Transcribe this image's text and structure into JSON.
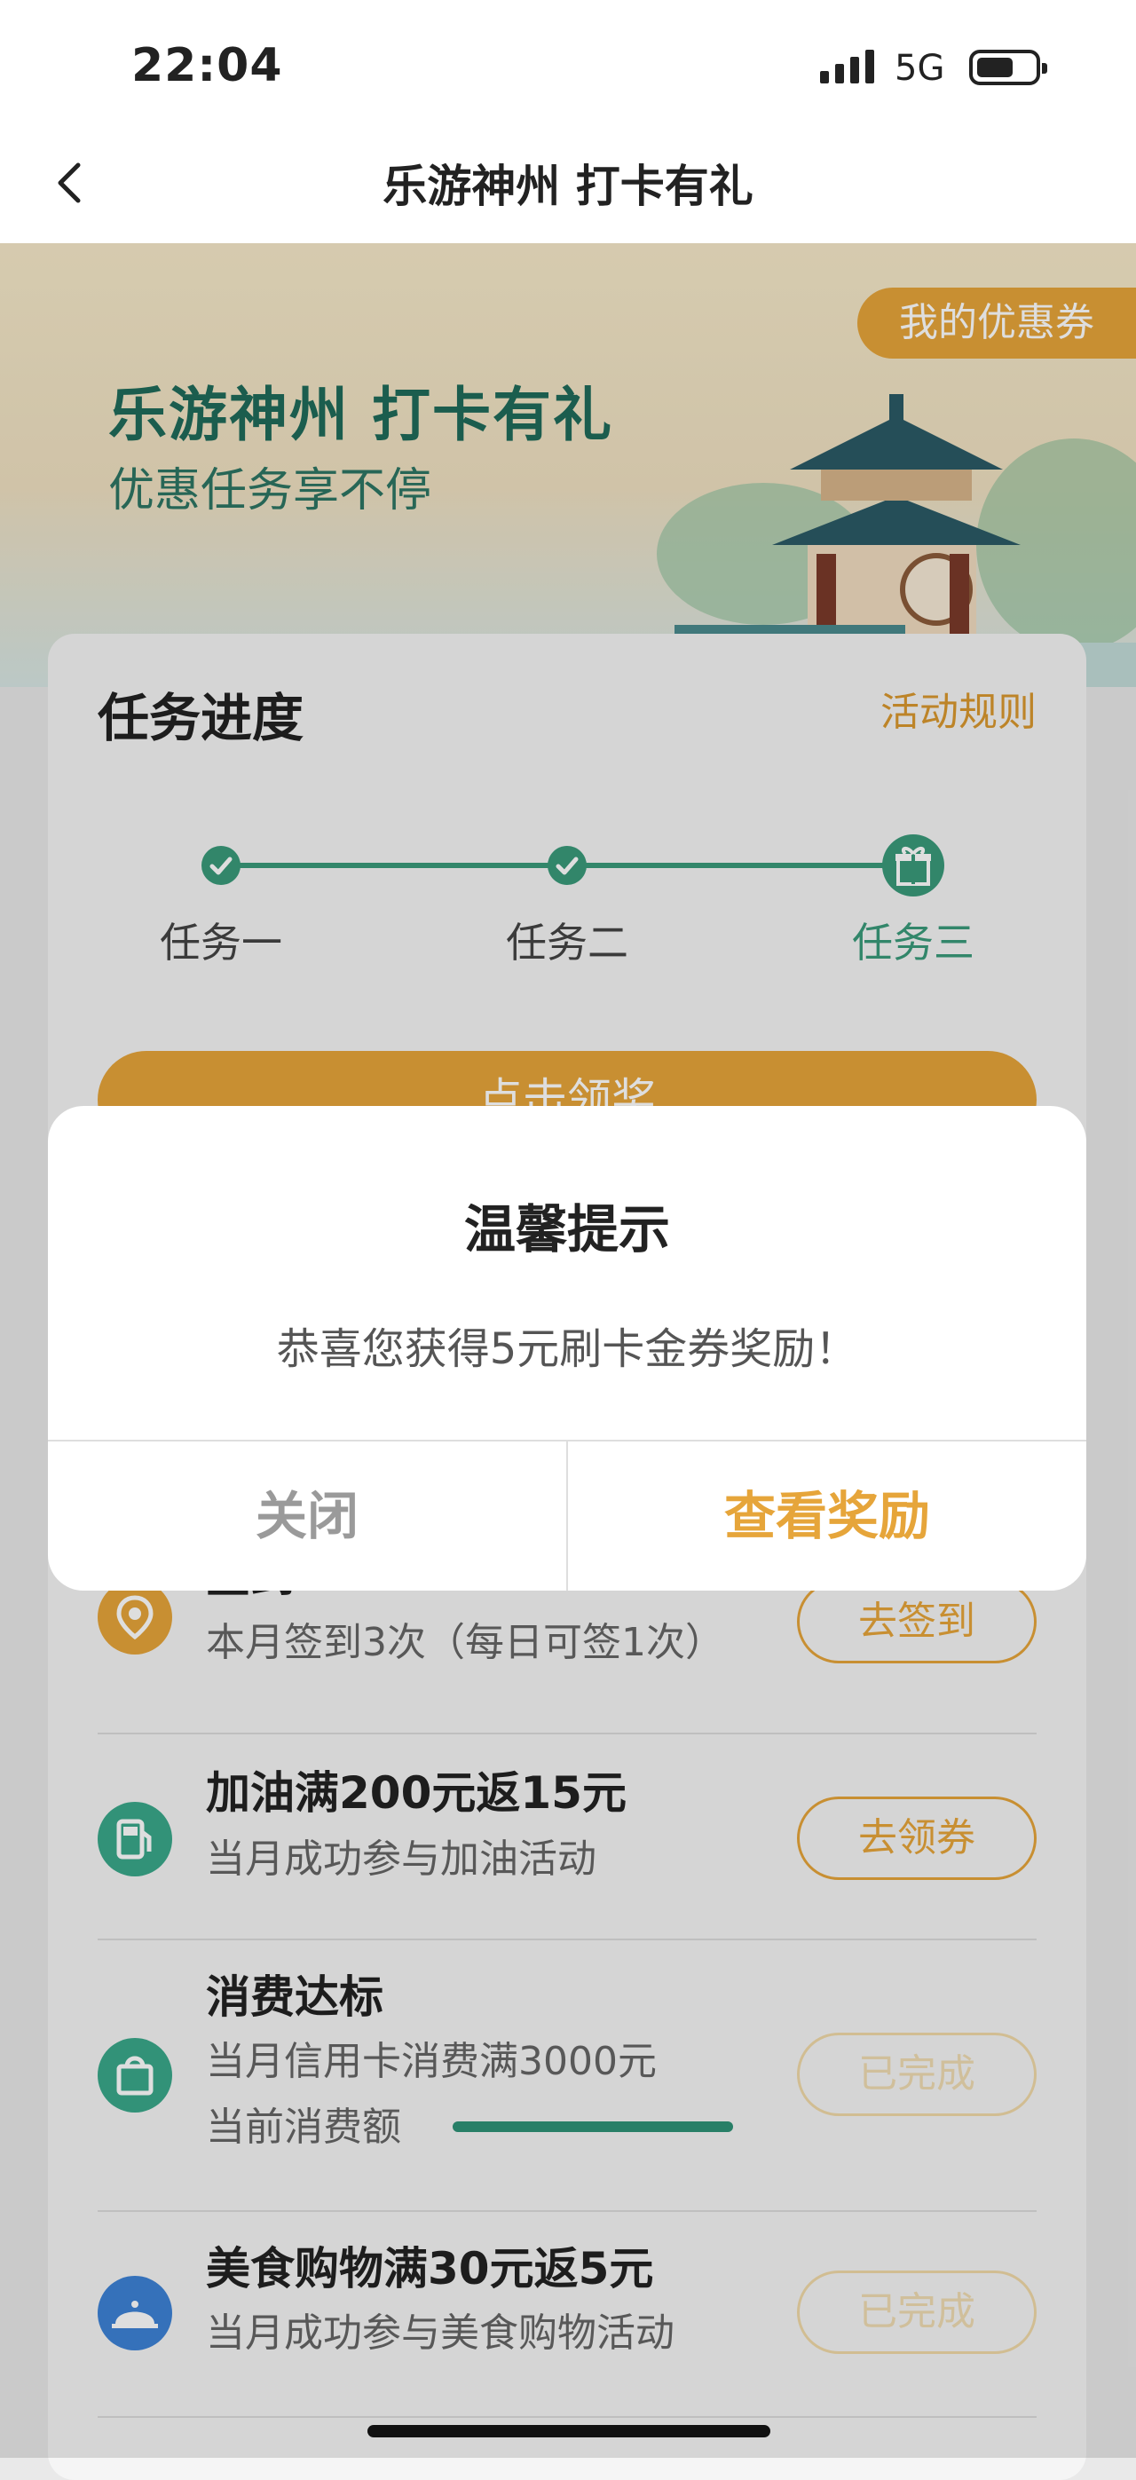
{
  "status_bar": {
    "time": "22:04",
    "network": "5G"
  },
  "nav": {
    "title": "乐游神州 打卡有礼"
  },
  "banner": {
    "title": "乐游神州  打卡有礼",
    "subtitle": "优惠任务享不停",
    "coupon_button": "我的优惠券"
  },
  "progress": {
    "title": "任务进度",
    "rules_link": "活动规则",
    "steps": [
      "任务一",
      "任务二",
      "任务三"
    ],
    "claim_button": "点击领奖"
  },
  "tasks": [
    {
      "name": "签到",
      "desc": "本月签到3次（每日可签1次）",
      "button": "去签到",
      "icon": "location-pin-icon",
      "color": "#e6a53a"
    },
    {
      "name": "加油满200元返15元",
      "desc": "当月成功参与加油活动",
      "button": "去领券",
      "icon": "gas-pump-icon",
      "color": "#3aa88a"
    },
    {
      "name": "消费达标",
      "desc": "当月信用卡消费满3000元",
      "desc2": "当前消费额",
      "button": "已完成",
      "icon": "shopping-bag-icon",
      "color": "#3aa88a",
      "progress": 1.0
    },
    {
      "name": "美食购物满30元返5元",
      "desc": "当月成功参与美食购物活动",
      "button": "已完成",
      "icon": "food-cloche-icon",
      "color": "#3d82d6"
    }
  ],
  "modal": {
    "title": "温馨提示",
    "message": "恭喜您获得5元刷卡金券奖励！",
    "close_button": "关闭",
    "view_button": "查看奖励"
  },
  "colors": {
    "accent": "#e6a53a",
    "green": "#3a9a7a"
  }
}
